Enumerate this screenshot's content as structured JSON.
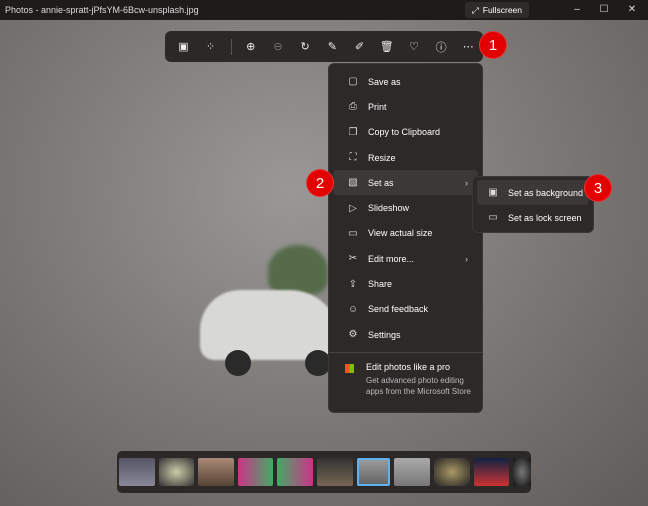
{
  "window": {
    "title": "Photos - annie-spratt-jPfsYM-6Bcw-unsplash.jpg",
    "fullscreen_label": "Fullscreen"
  },
  "toolbar": {
    "icons": [
      "photo-icon",
      "collage-icon",
      "zoom-in-icon",
      "zoom-out-icon",
      "rotate-icon",
      "edit-image-icon",
      "draw-icon",
      "delete-icon",
      "favorite-heart-icon",
      "info-icon",
      "more-icon"
    ]
  },
  "menu": {
    "items": [
      {
        "label": "Save as",
        "icon": "save-icon"
      },
      {
        "label": "Print",
        "icon": "print-icon"
      },
      {
        "label": "Copy to Clipboard",
        "icon": "copy-icon"
      },
      {
        "label": "Resize",
        "icon": "resize-icon"
      },
      {
        "label": "Set as",
        "icon": "set-as-icon",
        "submenu": true
      },
      {
        "label": "Slideshow",
        "icon": "slideshow-icon"
      },
      {
        "label": "View actual size",
        "icon": "actual-size-icon"
      },
      {
        "label": "Edit more...",
        "icon": "edit-more-icon",
        "submenu": true
      },
      {
        "label": "Share",
        "icon": "share-icon"
      },
      {
        "label": "Send feedback",
        "icon": "feedback-icon"
      },
      {
        "label": "Settings",
        "icon": "gear-icon"
      }
    ],
    "promo": {
      "title": "Edit photos like a pro",
      "subtitle": "Get advanced photo editing apps from the Microsoft Store"
    }
  },
  "submenu": {
    "items": [
      {
        "label": "Set as background"
      },
      {
        "label": "Set as lock screen"
      }
    ]
  },
  "badges": [
    "1",
    "2",
    "3"
  ],
  "colors": {
    "badge": "#e30000",
    "selection": "#5fb2f2"
  }
}
